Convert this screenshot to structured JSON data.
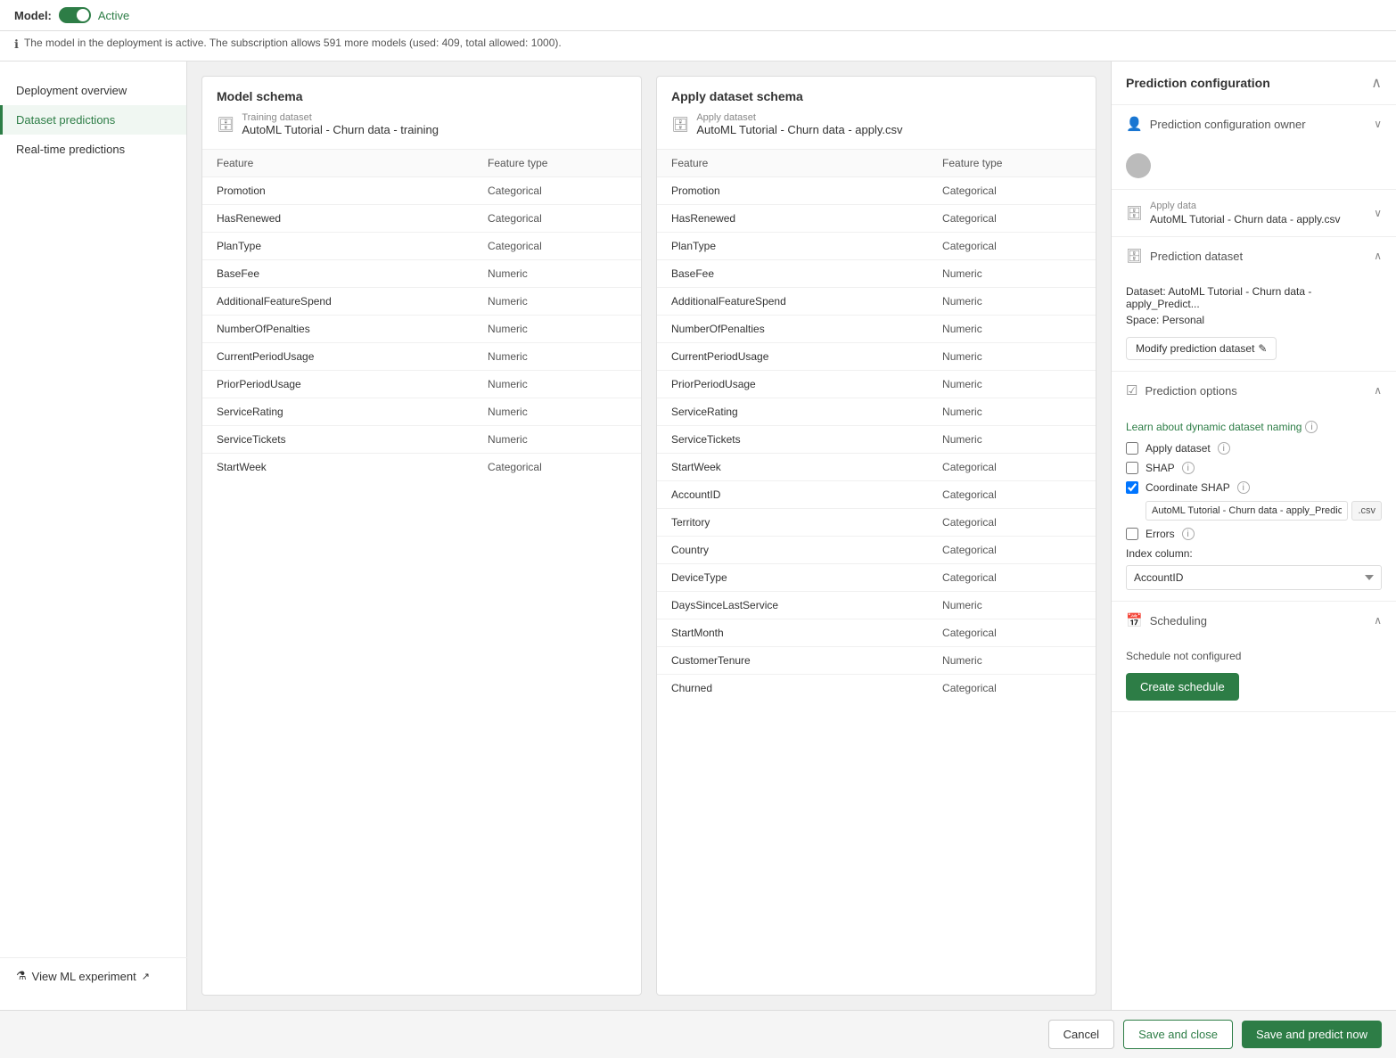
{
  "topBar": {
    "modelLabel": "Model:",
    "activeLabel": "Active"
  },
  "infoBar": {
    "text": "The model in the deployment is active. The subscription allows 591 more models (used: 409, total allowed: 1000)."
  },
  "sidebar": {
    "items": [
      {
        "id": "deployment-overview",
        "label": "Deployment overview",
        "active": false
      },
      {
        "id": "dataset-predictions",
        "label": "Dataset predictions",
        "active": true
      },
      {
        "id": "real-time-predictions",
        "label": "Real-time predictions",
        "active": false
      }
    ],
    "viewExperiment": "View ML experiment"
  },
  "modelSchema": {
    "title": "Model schema",
    "datasetLabel": "Training dataset",
    "datasetName": "AutoML Tutorial - Churn data - training",
    "columns": [
      {
        "feature": "Feature",
        "type": "Feature type",
        "isHeader": true
      },
      {
        "feature": "Promotion",
        "type": "Categorical"
      },
      {
        "feature": "HasRenewed",
        "type": "Categorical"
      },
      {
        "feature": "PlanType",
        "type": "Categorical"
      },
      {
        "feature": "BaseFee",
        "type": "Numeric"
      },
      {
        "feature": "AdditionalFeatureSpend",
        "type": "Numeric"
      },
      {
        "feature": "NumberOfPenalties",
        "type": "Numeric"
      },
      {
        "feature": "CurrentPeriodUsage",
        "type": "Numeric"
      },
      {
        "feature": "PriorPeriodUsage",
        "type": "Numeric"
      },
      {
        "feature": "ServiceRating",
        "type": "Numeric"
      },
      {
        "feature": "ServiceTickets",
        "type": "Numeric"
      },
      {
        "feature": "StartWeek",
        "type": "Categorical"
      }
    ]
  },
  "applySchema": {
    "title": "Apply dataset schema",
    "datasetLabel": "Apply dataset",
    "datasetName": "AutoML Tutorial - Churn data - apply.csv",
    "columns": [
      {
        "feature": "Feature",
        "type": "Feature type",
        "isHeader": true
      },
      {
        "feature": "Promotion",
        "type": "Categorical"
      },
      {
        "feature": "HasRenewed",
        "type": "Categorical"
      },
      {
        "feature": "PlanType",
        "type": "Categorical"
      },
      {
        "feature": "BaseFee",
        "type": "Numeric"
      },
      {
        "feature": "AdditionalFeatureSpend",
        "type": "Numeric"
      },
      {
        "feature": "NumberOfPenalties",
        "type": "Numeric"
      },
      {
        "feature": "CurrentPeriodUsage",
        "type": "Numeric"
      },
      {
        "feature": "PriorPeriodUsage",
        "type": "Numeric"
      },
      {
        "feature": "ServiceRating",
        "type": "Numeric"
      },
      {
        "feature": "ServiceTickets",
        "type": "Numeric"
      },
      {
        "feature": "StartWeek",
        "type": "Categorical"
      },
      {
        "feature": "AccountID",
        "type": "Categorical"
      },
      {
        "feature": "Territory",
        "type": "Categorical"
      },
      {
        "feature": "Country",
        "type": "Categorical"
      },
      {
        "feature": "DeviceType",
        "type": "Categorical"
      },
      {
        "feature": "DaysSinceLastService",
        "type": "Numeric"
      },
      {
        "feature": "StartMonth",
        "type": "Categorical"
      },
      {
        "feature": "CustomerTenure",
        "type": "Numeric"
      },
      {
        "feature": "Churned",
        "type": "Categorical"
      }
    ]
  },
  "rightPanel": {
    "title": "Prediction configuration",
    "sections": {
      "owner": {
        "label": "Prediction configuration owner"
      },
      "applyData": {
        "label": "Apply data",
        "value": "AutoML Tutorial - Churn data - apply.csv"
      },
      "predictionDataset": {
        "label": "Prediction dataset",
        "datasetText": "Dataset: AutoML Tutorial - Churn data - apply_Predict...",
        "spaceText": "Space: Personal",
        "modifyBtn": "Modify prediction dataset"
      },
      "predictionOptions": {
        "label": "Prediction options",
        "learnLink": "Learn about dynamic dataset naming",
        "applyDatasetCheck": "Apply dataset",
        "shapCheck": "SHAP",
        "coordinateShapCheck": "Coordinate SHAP",
        "shapInputValue": "AutoML Tutorial - Churn data - apply_Predictic",
        "shapInputExt": ".csv",
        "errorsCheck": "Errors",
        "indexColumnLabel": "Index column:",
        "indexColumnValue": "AccountID"
      },
      "scheduling": {
        "label": "Scheduling",
        "statusText": "Schedule not configured",
        "createScheduleBtn": "Create schedule"
      }
    }
  },
  "footer": {
    "cancelLabel": "Cancel",
    "saveCloseLabel": "Save and close",
    "savePredictLabel": "Save and predict now"
  }
}
